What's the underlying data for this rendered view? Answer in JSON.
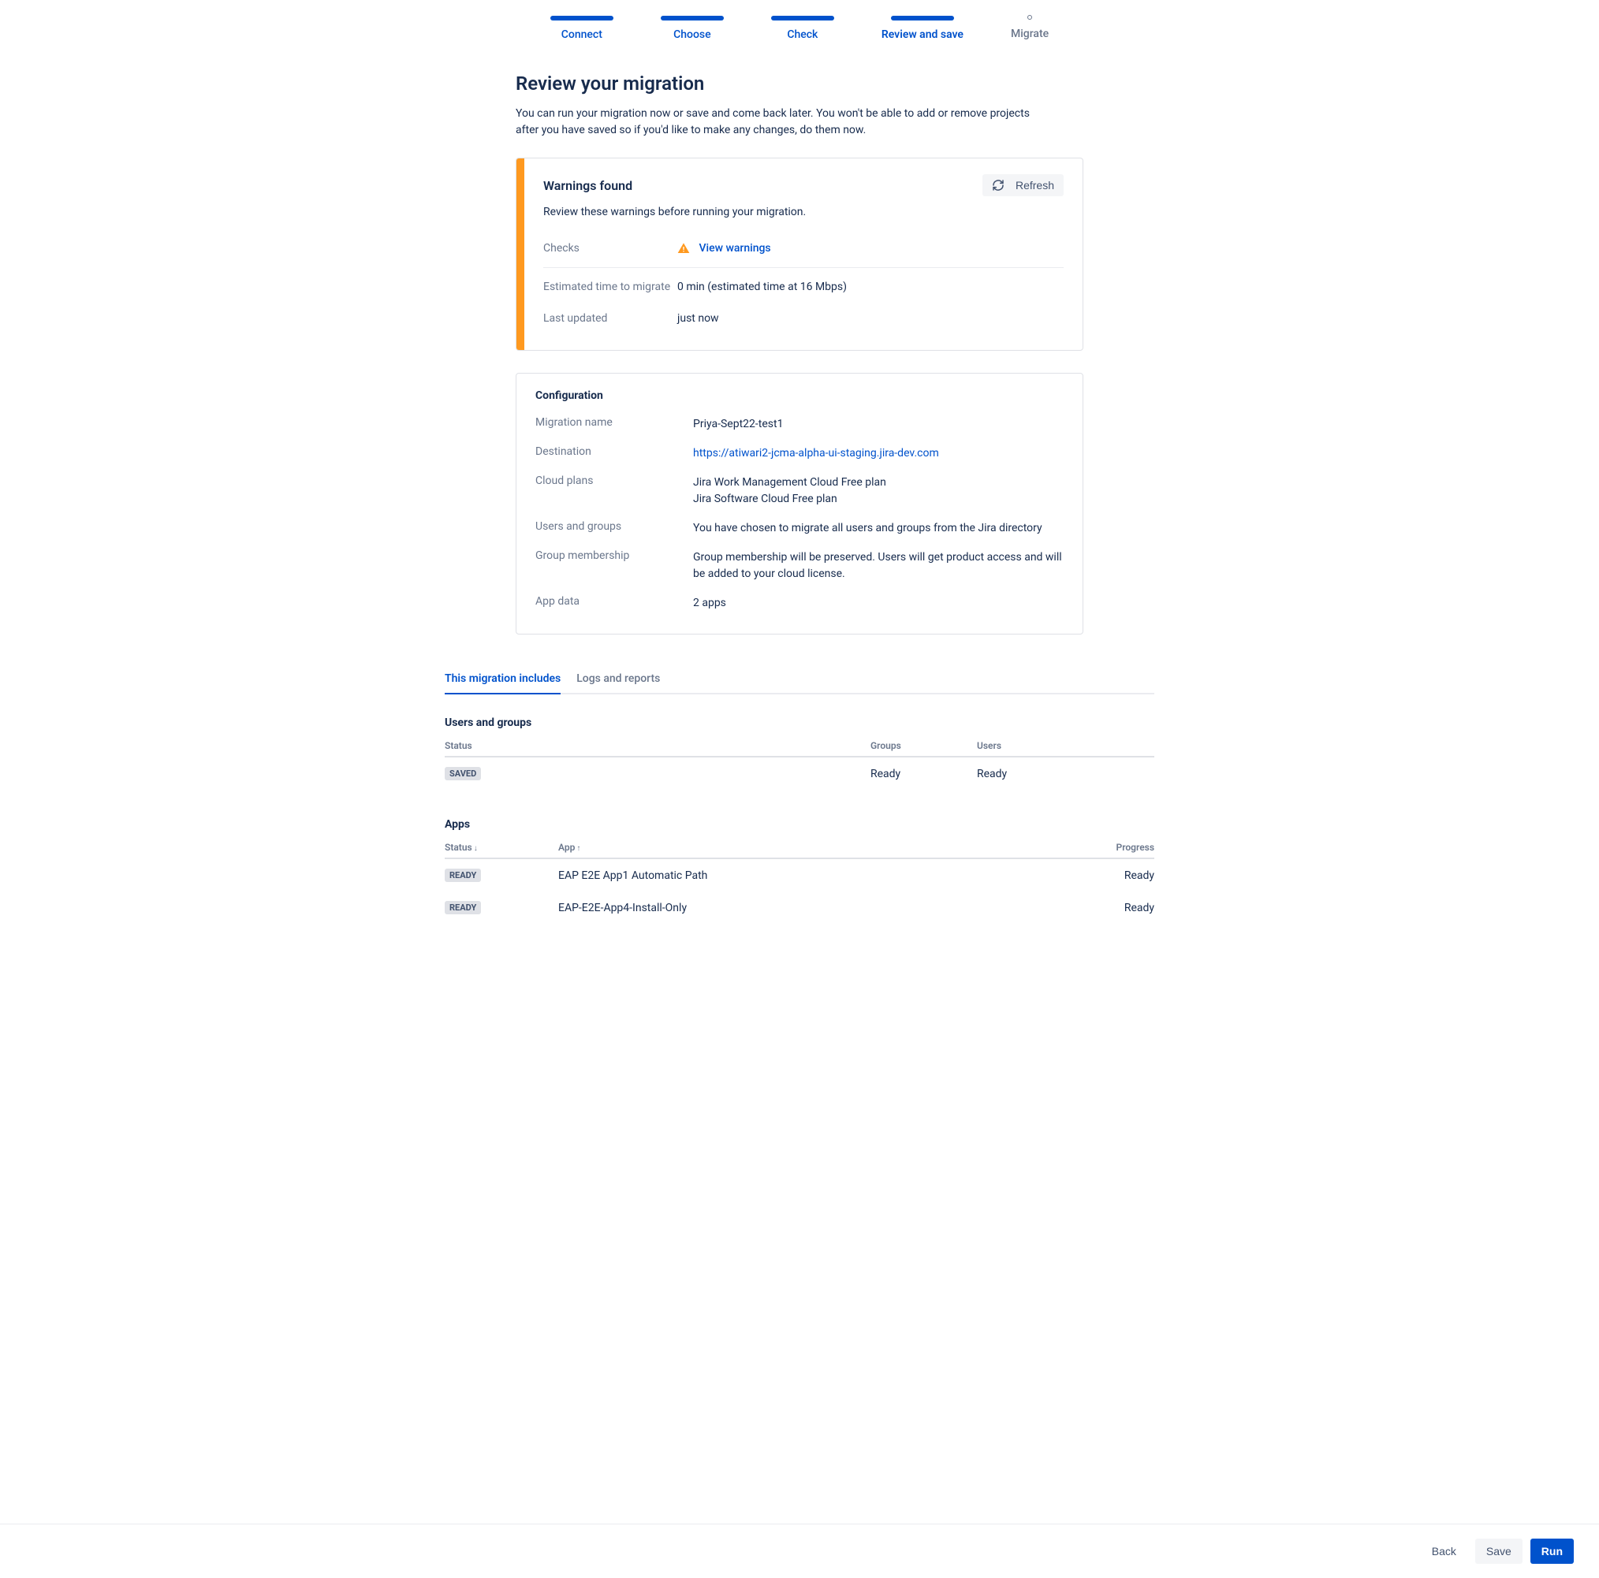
{
  "stepper": {
    "steps": [
      {
        "label": "Connect",
        "state": "done"
      },
      {
        "label": "Choose",
        "state": "done"
      },
      {
        "label": "Check",
        "state": "done"
      },
      {
        "label": "Review and save",
        "state": "current"
      },
      {
        "label": "Migrate",
        "state": "pending"
      }
    ]
  },
  "page": {
    "title": "Review your migration",
    "description": "You can run your migration now or save and come back later. You won't be able to add or remove projects after you have saved so if you'd like to make any changes, do them now."
  },
  "warnings": {
    "title": "Warnings found",
    "refresh_label": "Refresh",
    "subtitle": "Review these warnings before running your migration.",
    "checks_label": "Checks",
    "view_warnings_link": "View warnings",
    "est_label": "Estimated time to migrate",
    "est_value": "0 min (estimated time at 16 Mbps)",
    "updated_label": "Last updated",
    "updated_value": "just now"
  },
  "config": {
    "title": "Configuration",
    "rows": {
      "migration_name": {
        "label": "Migration name",
        "value": "Priya-Sept22-test1"
      },
      "destination": {
        "label": "Destination",
        "value": "https://atiwari2-jcma-alpha-ui-staging.jira-dev.com"
      },
      "cloud_plans": {
        "label": "Cloud plans",
        "line1": "Jira Work Management Cloud Free plan",
        "line2": "Jira Software Cloud Free plan"
      },
      "users_groups": {
        "label": "Users and groups",
        "value": "You have chosen to migrate all users and groups from the Jira directory"
      },
      "group_membership": {
        "label": "Group membership",
        "value": "Group membership will be preserved. Users will get product access and will be added to your cloud license."
      },
      "app_data": {
        "label": "App data",
        "value": "2 apps"
      }
    }
  },
  "tabs": {
    "includes": "This migration includes",
    "logs": "Logs and reports"
  },
  "users_section": {
    "title": "Users and groups",
    "headers": {
      "status": "Status",
      "groups": "Groups",
      "users": "Users"
    },
    "row": {
      "status_badge": "Saved",
      "groups": "Ready",
      "users": "Ready"
    }
  },
  "apps_section": {
    "title": "Apps",
    "headers": {
      "status": "Status",
      "app": "App",
      "progress": "Progress"
    },
    "rows": [
      {
        "status_badge": "Ready",
        "app": "EAP E2E App1 Automatic Path",
        "progress": "Ready"
      },
      {
        "status_badge": "Ready",
        "app": "EAP-E2E-App4-Install-Only",
        "progress": "Ready"
      }
    ]
  },
  "footer": {
    "back": "Back",
    "save": "Save",
    "run": "Run"
  }
}
